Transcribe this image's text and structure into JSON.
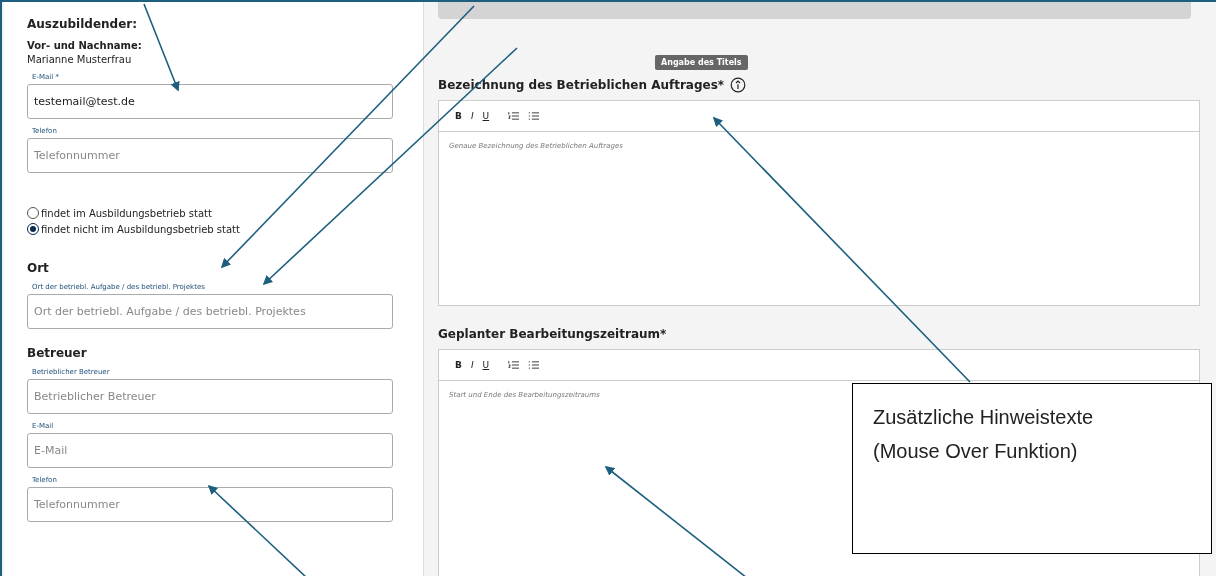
{
  "student": {
    "heading": "Auszubildender:",
    "name_label": "Vor- und Nachname:",
    "name": "Marianne Musterfrau",
    "fields": [
      {
        "label": "E-Mail *",
        "value": "testemail@test.de"
      },
      {
        "label": "Telefon",
        "placeholder": "Telefonnummer"
      }
    ]
  },
  "location_options": [
    {
      "label": "findet im Ausbildungsbetrieb statt",
      "selected": false
    },
    {
      "label": "findet nicht im Ausbildungsbetrieb statt",
      "selected": true
    }
  ],
  "location": {
    "heading": "Ort",
    "fields": [
      {
        "label": "Ort der betriebl. Aufgabe / des betriebl. Projektes",
        "placeholder": "Ort der betriebl. Aufgabe / des betriebl. Projektes"
      }
    ]
  },
  "supervisor": {
    "heading": "Betreuer",
    "fields": [
      {
        "label": "Betrieblicher Betreuer",
        "placeholder": "Betrieblicher Betreuer"
      },
      {
        "label": "E-Mail",
        "placeholder": "E-Mail"
      },
      {
        "label": "Telefon",
        "placeholder": "Telefonnummer"
      }
    ]
  },
  "tooltip": "Angabe des Titels",
  "editors": [
    {
      "label": "Bezeichnung des Betrieblichen Auftrages*",
      "info": true,
      "toolbar": [
        "B",
        "I",
        "U"
      ],
      "placeholder": "Genaue Bezeichnung des Betrieblichen Auftrages"
    },
    {
      "label": "Geplanter Bearbeitungszeitraum*",
      "info": false,
      "toolbar": [
        "B",
        "I",
        "U"
      ],
      "placeholder": "Start und Ende des Bearbeitungszeitraums"
    }
  ],
  "callout": {
    "lines": [
      "Zusätzliche Hinweistexte",
      "(Mouse Over Funktion)"
    ]
  }
}
